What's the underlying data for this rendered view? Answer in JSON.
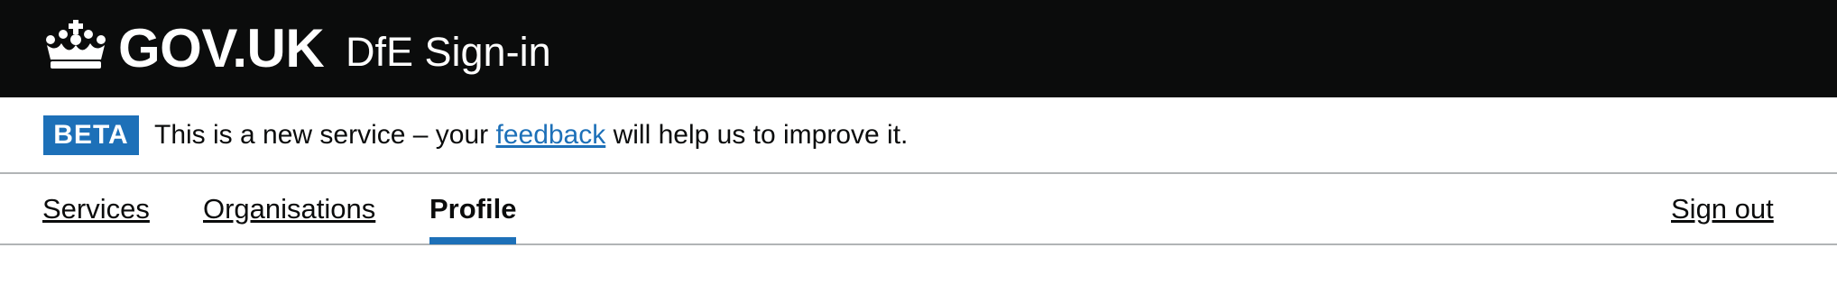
{
  "header": {
    "logo_text": "GOV.UK",
    "service_name": "DfE Sign-in",
    "logo_icon": "crown-icon",
    "background": "#0b0c0c"
  },
  "phase_banner": {
    "tag": "BETA",
    "text_before": "This is a new service – your ",
    "link_text": "feedback",
    "text_after": " will help us to improve it.",
    "tag_color": "#1d70b8"
  },
  "nav": {
    "items": [
      {
        "label": "Services",
        "active": false
      },
      {
        "label": "Organisations",
        "active": false
      },
      {
        "label": "Profile",
        "active": true
      }
    ],
    "sign_out": "Sign out",
    "active_color": "#1d70b8"
  }
}
